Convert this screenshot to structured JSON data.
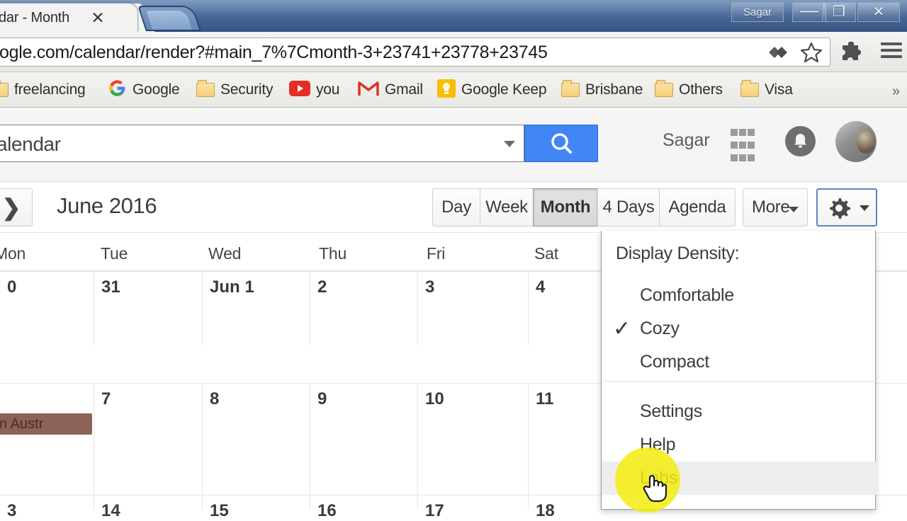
{
  "browser": {
    "tab_title": "alendar - Month",
    "tab_close_glyph": "✕",
    "url": "ogle.com/calendar/render?#main_7%7Cmonth-3+23741+23778+23745",
    "window_controls": {
      "profile_name": "Sagar",
      "minimize_glyph": "—",
      "maximize_glyph": "❐",
      "close_glyph": "✕"
    },
    "bookmarks": [
      {
        "label": "freelancing",
        "icon": "folder-icon"
      },
      {
        "label": "Google",
        "icon": "google-icon"
      },
      {
        "label": "Security",
        "icon": "folder-icon"
      },
      {
        "label": "you",
        "icon": "youtube-icon"
      },
      {
        "label": "Gmail",
        "icon": "gmail-icon"
      },
      {
        "label": "Google Keep",
        "icon": "keep-bulb-icon"
      },
      {
        "label": "Brisbane",
        "icon": "folder-icon"
      },
      {
        "label": "Others",
        "icon": "folder-icon"
      },
      {
        "label": "Visa",
        "icon": "folder-icon"
      }
    ],
    "bookmarks_overflow_glyph": "»"
  },
  "gcal_header": {
    "search_value": "alendar",
    "search_placeholder": "Search",
    "search_icon": "search-icon",
    "account_name": "Sagar",
    "apps_icon": "apps-grid-icon",
    "notifications_icon": "bell-icon",
    "avatar_icon": "avatar"
  },
  "toolbar": {
    "next_glyph": "❯",
    "title": "June 2016",
    "views": [
      {
        "label": "Day",
        "active": false
      },
      {
        "label": "Week",
        "active": false
      },
      {
        "label": "Month",
        "active": true
      },
      {
        "label": "4 Days",
        "active": false
      },
      {
        "label": "Agenda",
        "active": false
      }
    ],
    "more_label": "More",
    "settings_icon": "gear-icon"
  },
  "calendar": {
    "day_headers": [
      "Mon",
      "Tue",
      "Wed",
      "Thu",
      "Fri",
      "Sat"
    ],
    "weeks": [
      {
        "days": [
          "0",
          "31",
          "Jun 1",
          "2",
          "3",
          "4"
        ]
      },
      {
        "days": [
          "",
          "7",
          "8",
          "9",
          "10",
          "11"
        ]
      },
      {
        "days": [
          "3",
          "14",
          "15",
          "16",
          "17",
          "18"
        ]
      }
    ],
    "event": {
      "title": "Western Austr",
      "color": "#8d6257"
    }
  },
  "settings_menu": {
    "density_label": "Display Density:",
    "items": [
      {
        "label": "Comfortable",
        "checked": false,
        "hovered": false
      },
      {
        "label": "Cozy",
        "checked": true,
        "hovered": false
      },
      {
        "label": "Compact",
        "checked": false,
        "hovered": false
      },
      {
        "label": "Settings",
        "checked": false,
        "hovered": false
      },
      {
        "label": "Help",
        "checked": false,
        "hovered": false
      },
      {
        "label": "Labs",
        "checked": false,
        "hovered": true
      }
    ],
    "check_glyph": "✓",
    "highlight_color": "#f2ec0c"
  }
}
